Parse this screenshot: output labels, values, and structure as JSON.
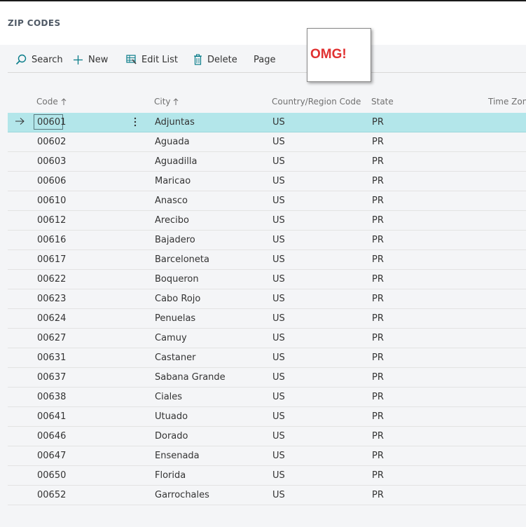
{
  "page": {
    "title": "ZIP CODES"
  },
  "toolbar": {
    "search": "Search",
    "new": "New",
    "edit_list": "Edit List",
    "delete": "Delete",
    "page": "Page"
  },
  "callout": {
    "text": "OMG!"
  },
  "columns": {
    "code": "Code",
    "city": "City",
    "country": "Country/Region Code",
    "state": "State",
    "time_zone": "Time Zone"
  },
  "colors": {
    "selected_row": "#b3e6ea",
    "accent": "#0a7d8a",
    "callout_text": "#e03131"
  },
  "rows": [
    {
      "code": "00601",
      "city": "Adjuntas",
      "country": "US",
      "state": "PR"
    },
    {
      "code": "00602",
      "city": "Aguada",
      "country": "US",
      "state": "PR"
    },
    {
      "code": "00603",
      "city": "Aguadilla",
      "country": "US",
      "state": "PR"
    },
    {
      "code": "00606",
      "city": "Maricao",
      "country": "US",
      "state": "PR"
    },
    {
      "code": "00610",
      "city": "Anasco",
      "country": "US",
      "state": "PR"
    },
    {
      "code": "00612",
      "city": "Arecibo",
      "country": "US",
      "state": "PR"
    },
    {
      "code": "00616",
      "city": "Bajadero",
      "country": "US",
      "state": "PR"
    },
    {
      "code": "00617",
      "city": "Barceloneta",
      "country": "US",
      "state": "PR"
    },
    {
      "code": "00622",
      "city": "Boqueron",
      "country": "US",
      "state": "PR"
    },
    {
      "code": "00623",
      "city": "Cabo Rojo",
      "country": "US",
      "state": "PR"
    },
    {
      "code": "00624",
      "city": "Penuelas",
      "country": "US",
      "state": "PR"
    },
    {
      "code": "00627",
      "city": "Camuy",
      "country": "US",
      "state": "PR"
    },
    {
      "code": "00631",
      "city": "Castaner",
      "country": "US",
      "state": "PR"
    },
    {
      "code": "00637",
      "city": "Sabana Grande",
      "country": "US",
      "state": "PR"
    },
    {
      "code": "00638",
      "city": "Ciales",
      "country": "US",
      "state": "PR"
    },
    {
      "code": "00641",
      "city": "Utuado",
      "country": "US",
      "state": "PR"
    },
    {
      "code": "00646",
      "city": "Dorado",
      "country": "US",
      "state": "PR"
    },
    {
      "code": "00647",
      "city": "Ensenada",
      "country": "US",
      "state": "PR"
    },
    {
      "code": "00650",
      "city": "Florida",
      "country": "US",
      "state": "PR"
    },
    {
      "code": "00652",
      "city": "Garrochales",
      "country": "US",
      "state": "PR"
    }
  ]
}
